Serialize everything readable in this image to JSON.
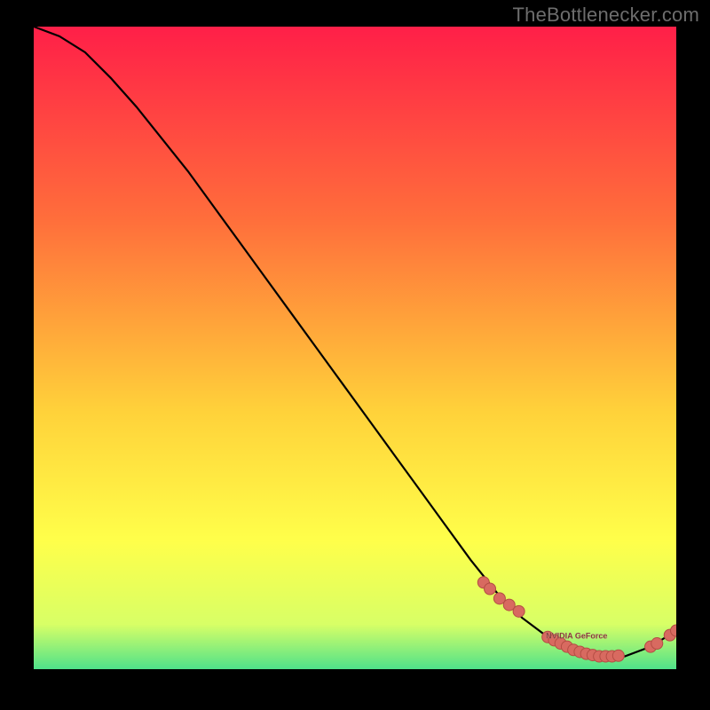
{
  "attribution": "TheBottlenecker.com",
  "colors": {
    "gradient_top": "#ff1f48",
    "gradient_mid1": "#ff6e3b",
    "gradient_mid2": "#ffd23a",
    "gradient_mid3": "#ffff4a",
    "gradient_bottom1": "#d8ff66",
    "gradient_bottom2": "#4fe28a",
    "line": "#000000",
    "marker_fill": "#d86a60",
    "marker_stroke": "#b44d44",
    "frame_bg": "#000000"
  },
  "chart_data": {
    "type": "line",
    "title": "",
    "xlabel": "",
    "ylabel": "",
    "xlim": [
      0,
      100
    ],
    "ylim": [
      0,
      100
    ],
    "x": [
      0,
      4,
      8,
      12,
      16,
      20,
      24,
      28,
      32,
      36,
      40,
      44,
      48,
      52,
      56,
      60,
      64,
      68,
      72,
      76,
      80,
      84,
      88,
      92,
      96,
      100
    ],
    "values": [
      100,
      98.5,
      96,
      92,
      87.5,
      82.5,
      77.5,
      72,
      66.5,
      61,
      55.5,
      50,
      44.5,
      39,
      33.5,
      28,
      22.5,
      17,
      12,
      8,
      5,
      3,
      2,
      2,
      3.5,
      6
    ],
    "marker_clusters": [
      {
        "points": [
          {
            "x": 70,
            "y": 13.5
          },
          {
            "x": 71,
            "y": 12.5
          },
          {
            "x": 72.5,
            "y": 11
          },
          {
            "x": 74,
            "y": 10
          },
          {
            "x": 75.5,
            "y": 9
          }
        ]
      },
      {
        "points": [
          {
            "x": 80,
            "y": 5
          },
          {
            "x": 81,
            "y": 4.5
          },
          {
            "x": 82,
            "y": 4
          },
          {
            "x": 83,
            "y": 3.5
          },
          {
            "x": 84,
            "y": 3
          },
          {
            "x": 85,
            "y": 2.7
          },
          {
            "x": 86,
            "y": 2.4
          },
          {
            "x": 87,
            "y": 2.2
          },
          {
            "x": 88,
            "y": 2
          },
          {
            "x": 89,
            "y": 2
          },
          {
            "x": 90,
            "y": 2
          },
          {
            "x": 91,
            "y": 2.1
          }
        ]
      },
      {
        "points": [
          {
            "x": 96,
            "y": 3.5
          },
          {
            "x": 97,
            "y": 4
          }
        ]
      },
      {
        "points": [
          {
            "x": 99,
            "y": 5.3
          },
          {
            "x": 100,
            "y": 6
          }
        ]
      }
    ],
    "annotation": {
      "text": "NVIDIA GeForce",
      "x": 84.5,
      "y": 4.8
    }
  }
}
